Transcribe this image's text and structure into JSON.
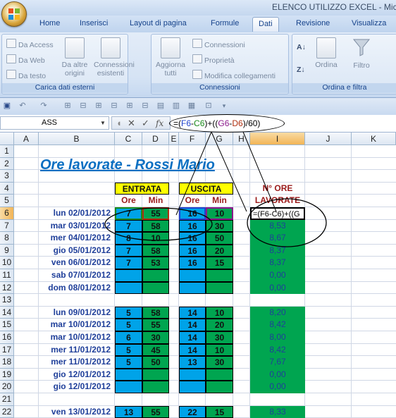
{
  "window": {
    "title": "ELENCO UTILIZZO EXCEL - Mic"
  },
  "tabs": [
    "Home",
    "Inserisci",
    "Layout di pagina",
    "Formule",
    "Dati",
    "Revisione",
    "Visualizza"
  ],
  "active_tab": "Dati",
  "ribbon": {
    "external_data": {
      "label": "Carica dati esterni",
      "access": "Da Access",
      "web": "Da Web",
      "text": "Da testo",
      "other": [
        "Da altre",
        "origini"
      ],
      "existing": [
        "Connessioni",
        "esistenti"
      ]
    },
    "connections": {
      "label": "Connessioni",
      "refresh": [
        "Aggiorna",
        "tutti"
      ],
      "connections": "Connessioni",
      "properties": "Proprietà",
      "edit_links": "Modifica collegamenti"
    },
    "sort_filter": {
      "label": "Ordina e filtra",
      "sort": "Ordina",
      "filter": "Filtro"
    }
  },
  "formula_bar": {
    "name_box": "ASS",
    "fx": "fx",
    "formula_parts": [
      {
        "t": "=(",
        "c": "#000000"
      },
      {
        "t": "F6",
        "c": "#2244cc"
      },
      {
        "t": "-",
        "c": "#000000"
      },
      {
        "t": "C6",
        "c": "#1a8a1a"
      },
      {
        "t": ")+((",
        "c": "#000000"
      },
      {
        "t": "G6",
        "c": "#8b1a8b"
      },
      {
        "t": "-",
        "c": "#000000"
      },
      {
        "t": "D6",
        "c": "#b03010"
      },
      {
        "t": ")/60)",
        "c": "#000000"
      }
    ]
  },
  "columns": [
    "A",
    "B",
    "C",
    "D",
    "E",
    "F",
    "G",
    "H",
    "I",
    "J",
    "K"
  ],
  "rows": [
    "1",
    "2",
    "3",
    "4",
    "5",
    "6",
    "7",
    "8",
    "9",
    "10",
    "11",
    "12",
    "13",
    "14",
    "15",
    "16",
    "17",
    "18",
    "19",
    "20",
    "21",
    "22"
  ],
  "sheet": {
    "title": "Ore lavorate - Rossi Mario",
    "entrata": "ENTRATA",
    "uscita": "USCITA",
    "ore": "Ore",
    "min": "Min",
    "ore_lavorate": [
      "N° ORE",
      "LAVORATE"
    ],
    "active_cell_text": "=(F6-C6)+((G",
    "records": [
      {
        "row": "6",
        "date": "lun 02/01/2012",
        "c": "7",
        "d": "55",
        "f": "16",
        "g": "10",
        "i": ""
      },
      {
        "row": "7",
        "date": "mar 03/01/2012",
        "c": "7",
        "d": "58",
        "f": "16",
        "g": "30",
        "i": "8,53"
      },
      {
        "row": "8",
        "date": "mer 04/01/2012",
        "c": "8",
        "d": "10",
        "f": "16",
        "g": "50",
        "i": "8,67"
      },
      {
        "row": "9",
        "date": "gio 05/01/2012",
        "c": "7",
        "d": "58",
        "f": "16",
        "g": "20",
        "i": "8,37"
      },
      {
        "row": "10",
        "date": "ven 06/01/2012",
        "c": "7",
        "d": "53",
        "f": "16",
        "g": "15",
        "i": "8,37"
      },
      {
        "row": "11",
        "date": "sab 07/01/2012",
        "c": "",
        "d": "",
        "f": "",
        "g": "",
        "i": "0,00"
      },
      {
        "row": "12",
        "date": "dom 08/01/2012",
        "c": "",
        "d": "",
        "f": "",
        "g": "",
        "i": "0,00"
      },
      {
        "row": "14",
        "date": "lun 09/01/2012",
        "c": "5",
        "d": "58",
        "f": "14",
        "g": "10",
        "i": "8,20"
      },
      {
        "row": "15",
        "date": "mar 10/01/2012",
        "c": "5",
        "d": "55",
        "f": "14",
        "g": "20",
        "i": "8,42"
      },
      {
        "row": "16",
        "date": "mar 10/01/2012",
        "c": "6",
        "d": "30",
        "f": "14",
        "g": "30",
        "i": "8,00"
      },
      {
        "row": "17",
        "date": "mer 11/01/2012",
        "c": "5",
        "d": "45",
        "f": "14",
        "g": "10",
        "i": "8,42"
      },
      {
        "row": "18",
        "date": "mer 11/01/2012",
        "c": "5",
        "d": "50",
        "f": "13",
        "g": "30",
        "i": "7,67"
      },
      {
        "row": "19",
        "date": "gio 12/01/2012",
        "c": "",
        "d": "",
        "f": "",
        "g": "",
        "i": "0,00"
      },
      {
        "row": "20",
        "date": "gio 12/01/2012",
        "c": "",
        "d": "",
        "f": "",
        "g": "",
        "i": "0,00"
      },
      {
        "row": "22",
        "date": "ven 13/01/2012",
        "c": "13",
        "d": "55",
        "f": "22",
        "g": "15",
        "i": "8,33"
      }
    ]
  }
}
